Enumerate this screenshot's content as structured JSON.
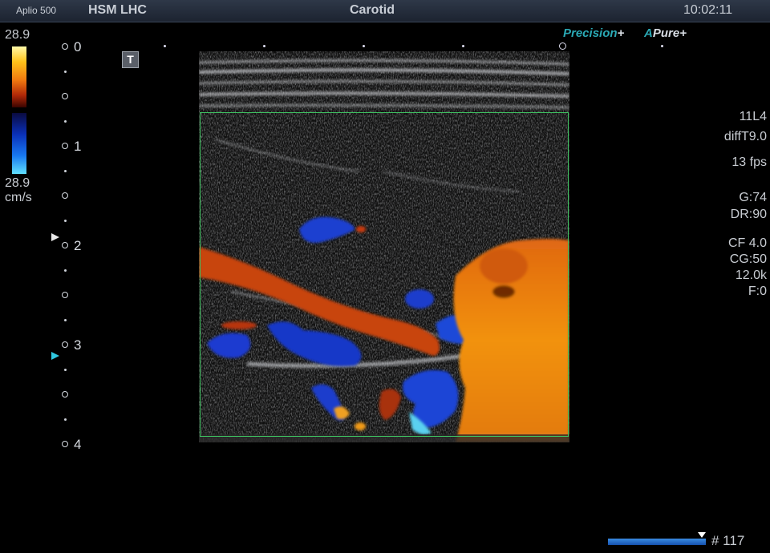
{
  "header": {
    "model": "Aplio 500",
    "hospital": "HSM LHC",
    "preset": "Carotid",
    "time": "10:02:11"
  },
  "color_scale": {
    "top_value": "28.9",
    "bottom_value": "28.9",
    "unit": "cm/s"
  },
  "depth_scale": {
    "labels": [
      "0",
      "1",
      "2",
      "3",
      "4"
    ]
  },
  "brands": {
    "precision": "Precision",
    "precision_plus": "+",
    "apure_a": "A",
    "apure": "Pure",
    "apure_plus": "+"
  },
  "params": {
    "probe": "11L4",
    "tissue": "diffT9.0",
    "fps": "13 fps",
    "gain": "G:74",
    "dynamic_range": "DR:90",
    "cf_freq": "CF 4.0",
    "color_gain": "CG:50",
    "prf": "12.0k",
    "filter": "F:0"
  },
  "cine": {
    "frame_label": "# 117"
  },
  "icons": {
    "text_tool": "T"
  },
  "colors": {
    "roi_border": "#3ec060",
    "flow_red": "#d6520f",
    "flow_blue": "#1a3fd0",
    "accent_teal": "#2aa8b4"
  }
}
